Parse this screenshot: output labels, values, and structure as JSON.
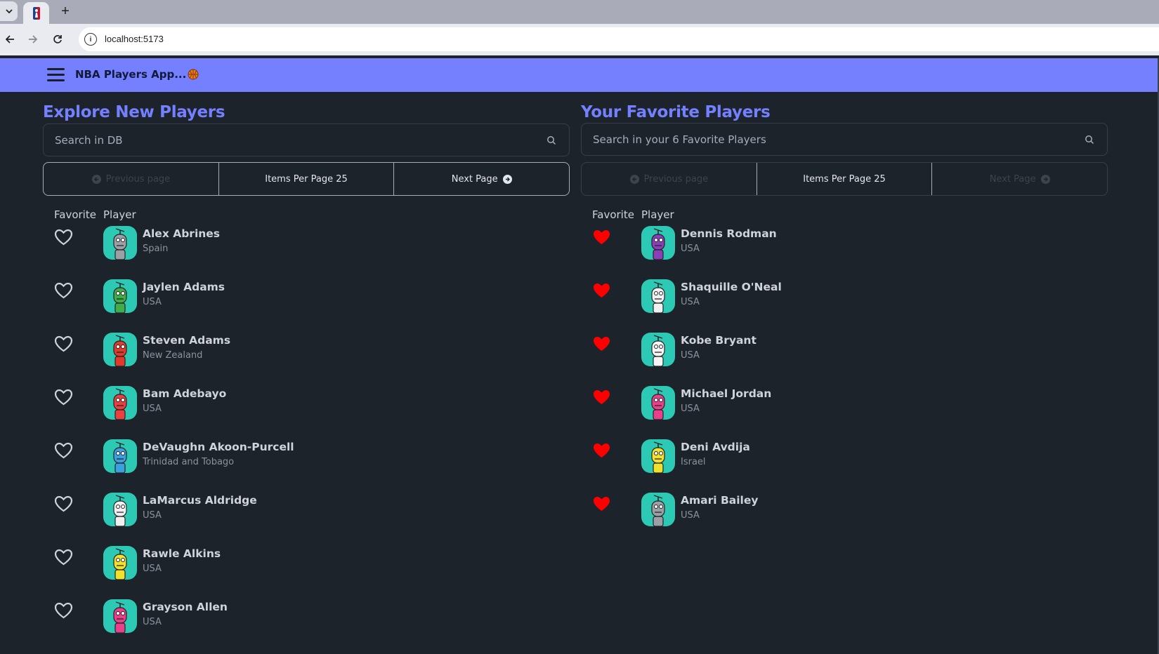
{
  "browser": {
    "url": "localhost:5173",
    "new_tab_label": "+"
  },
  "app": {
    "title": "NBA Players App...",
    "ball_icon": "basketball-icon",
    "accent": "#7480ff"
  },
  "explore": {
    "title": "Explore New Players",
    "search_placeholder": "Search in DB",
    "prev_label": "Previous page",
    "items_per_page_label": "Items Per Page 25",
    "next_label": "Next Page",
    "col_favorite": "Favorite",
    "col_player": "Player",
    "players": [
      {
        "name": "Alex Abrines",
        "country": "Spain",
        "favorite": false,
        "color": "#9aa0a6"
      },
      {
        "name": "Jaylen Adams",
        "country": "USA",
        "favorite": false,
        "color": "#3fae4a"
      },
      {
        "name": "Steven Adams",
        "country": "New Zealand",
        "favorite": false,
        "color": "#e03a2a"
      },
      {
        "name": "Bam Adebayo",
        "country": "USA",
        "favorite": false,
        "color": "#e84040"
      },
      {
        "name": "DeVaughn Akoon-Purcell",
        "country": "Trinidad and Tobago",
        "favorite": false,
        "color": "#3aa0e0"
      },
      {
        "name": "LaMarcus Aldridge",
        "country": "USA",
        "favorite": false,
        "color": "#f0f0f0"
      },
      {
        "name": "Rawle Alkins",
        "country": "USA",
        "favorite": false,
        "color": "#f2e12a"
      },
      {
        "name": "Grayson Allen",
        "country": "USA",
        "favorite": false,
        "color": "#e8408a"
      }
    ]
  },
  "favorites": {
    "title": "Your Favorite Players",
    "search_placeholder": "Search in your 6 Favorite Players",
    "prev_label": "Previous page",
    "items_per_page_label": "Items Per Page 25",
    "next_label": "Next Page",
    "col_favorite": "Favorite",
    "col_player": "Player",
    "players": [
      {
        "name": "Dennis Rodman",
        "country": "USA",
        "favorite": true,
        "color": "#8a3fb8"
      },
      {
        "name": "Shaquille O'Neal",
        "country": "USA",
        "favorite": true,
        "color": "#f0f0f0"
      },
      {
        "name": "Kobe Bryant",
        "country": "USA",
        "favorite": true,
        "color": "#f5f5f5"
      },
      {
        "name": "Michael Jordan",
        "country": "USA",
        "favorite": true,
        "color": "#e8408a"
      },
      {
        "name": "Deni Avdija",
        "country": "Israel",
        "favorite": true,
        "color": "#f2e12a"
      },
      {
        "name": "Amari Bailey",
        "country": "USA",
        "favorite": true,
        "color": "#9aa0a6"
      }
    ]
  },
  "colors": {
    "heart_filled": "#ff0000",
    "heart_outline": "#cfd3db",
    "avatar_bg": "#2cc9b4"
  }
}
